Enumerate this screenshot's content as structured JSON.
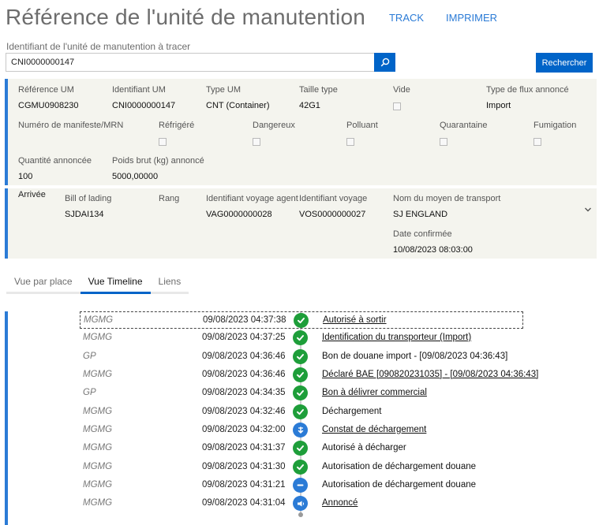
{
  "header": {
    "title": "Référence de l'unité de manutention",
    "links": {
      "track": "TRACK",
      "print": "IMPRIMER"
    }
  },
  "search": {
    "label": "Identifiant de l'unité de manutention à tracer",
    "value": "CNI0000000147",
    "button_label": "Rechercher"
  },
  "unit": {
    "reference_um": {
      "label": "Référence UM",
      "value": "CGMU0908230"
    },
    "identifiant_um": {
      "label": "Identifiant UM",
      "value": "CNI0000000147"
    },
    "type_um": {
      "label": "Type UM",
      "value": "CNT (Container)"
    },
    "taille_type": {
      "label": "Taille type",
      "value": "42G1"
    },
    "vide": {
      "label": "Vide",
      "checked": false
    },
    "type_flux": {
      "label": "Type de flux annoncé",
      "value": "Import"
    },
    "manifeste": {
      "label": "Numéro de manifeste/MRN",
      "value": ""
    },
    "refrigere": {
      "label": "Réfrigéré",
      "checked": false
    },
    "dangereux": {
      "label": "Dangereux",
      "checked": false
    },
    "polluant": {
      "label": "Polluant",
      "checked": false
    },
    "quarantaine": {
      "label": "Quarantaine",
      "checked": false
    },
    "fumigation": {
      "label": "Fumigation",
      "checked": false
    },
    "quantite": {
      "label": "Quantité annoncée",
      "value": "100"
    },
    "poids": {
      "label": "Poids brut (kg) annoncé",
      "value": "5000,00000"
    }
  },
  "arrival": {
    "section_label": "Arrivée",
    "bill_of_lading": {
      "label": "Bill of lading",
      "value": "SJDAI134"
    },
    "rang": {
      "label": "Rang",
      "value": ""
    },
    "voyage_agent": {
      "label": "Identifiant voyage agent",
      "value": "VAG0000000028"
    },
    "voyage": {
      "label": "Identifiant voyage",
      "value": "VOS0000000027"
    },
    "transport": {
      "label": "Nom du moyen de transport",
      "value": "SJ ENGLAND"
    },
    "date_confirmee": {
      "label": "Date confirmée",
      "value": "10/08/2023 08:03:00"
    }
  },
  "tabs": [
    "Vue par place",
    "Vue Timeline",
    "Liens"
  ],
  "active_tab": "Vue Timeline",
  "colors": {
    "accent": "#0064c8",
    "green": "#1e9e3a",
    "blue_icon": "#2b7bd6"
  },
  "timeline": [
    {
      "source": "MGMG",
      "datetime": "09/08/2023 04:37:38",
      "icon": "check-icon",
      "event": "Autorisé à sortir",
      "link": true
    },
    {
      "source": "MGMG",
      "datetime": "09/08/2023 04:37:25",
      "icon": "check-icon",
      "event": "Identification du transporteur (Import)",
      "link": true
    },
    {
      "source": "GP",
      "datetime": "09/08/2023 04:36:46",
      "icon": "check-icon",
      "event": "Bon de douane import - [09/08/2023 04:36:43]",
      "link": false
    },
    {
      "source": "MGMG",
      "datetime": "09/08/2023 04:36:46",
      "icon": "check-icon",
      "event": "Déclaré BAE [090820231035] - [09/08/2023 04:36:43]",
      "link": true
    },
    {
      "source": "GP",
      "datetime": "09/08/2023 04:34:35",
      "icon": "check-icon",
      "event": "Bon à délivrer commercial",
      "link": true
    },
    {
      "source": "MGMG",
      "datetime": "09/08/2023 04:32:46",
      "icon": "check-icon",
      "event": "Déchargement",
      "link": false
    },
    {
      "source": "MGMG",
      "datetime": "09/08/2023 04:32:00",
      "icon": "unload-icon",
      "event": "Constat de déchargement",
      "link": true
    },
    {
      "source": "MGMG",
      "datetime": "09/08/2023 04:31:37",
      "icon": "check-icon",
      "event": "Autorisé à décharger",
      "link": false
    },
    {
      "source": "MGMG",
      "datetime": "09/08/2023 04:31:30",
      "icon": "check-icon",
      "event": "Autorisation de déchargement douane",
      "link": false
    },
    {
      "source": "MGMG",
      "datetime": "09/08/2023 04:31:21",
      "icon": "minus-icon",
      "event": "Autorisation de déchargement douane",
      "link": false
    },
    {
      "source": "MGMG",
      "datetime": "09/08/2023 04:31:04",
      "icon": "announce-icon",
      "event": "Annoncé",
      "link": true
    }
  ]
}
